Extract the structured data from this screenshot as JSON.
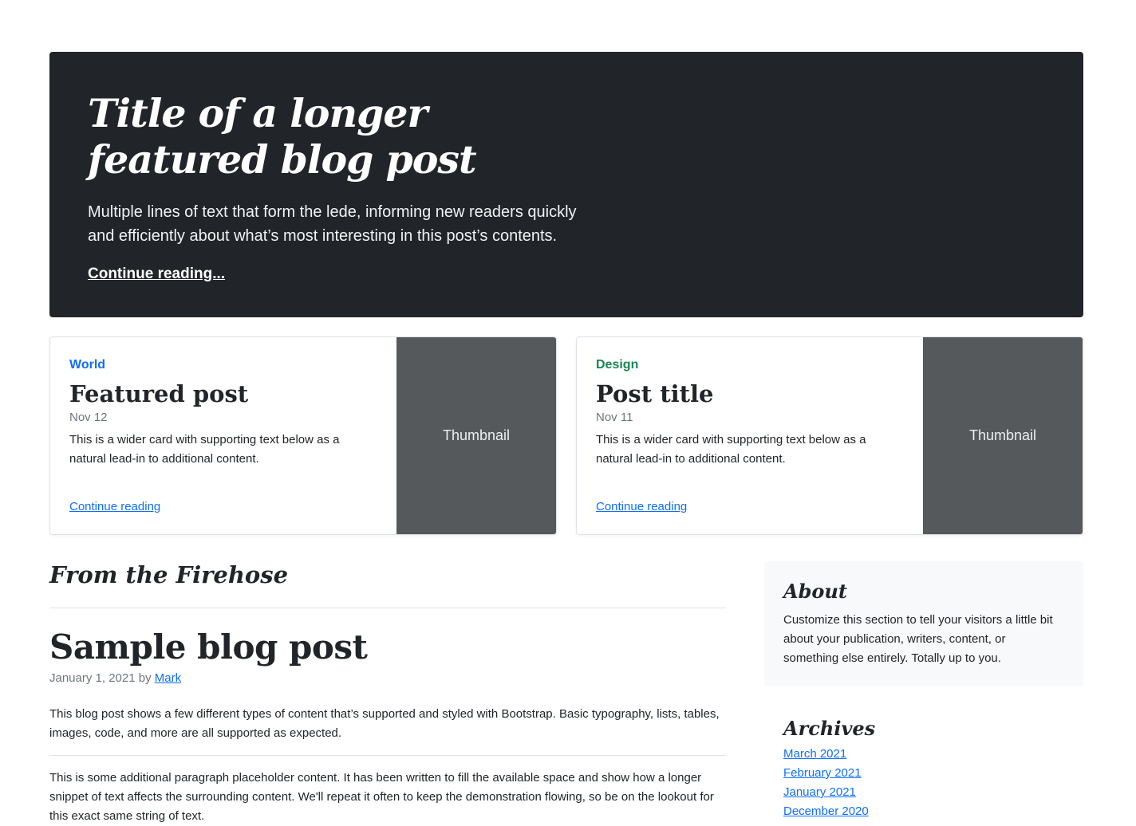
{
  "hero": {
    "title": "Title of a longer featured blog post",
    "lede": "Multiple lines of text that form the lede, informing new readers quickly and efficiently about what’s most interesting in this post’s contents.",
    "link": "Continue reading..."
  },
  "cards": [
    {
      "category": "World",
      "category_color": "#0d6efd",
      "title": "Featured post",
      "date": "Nov 12",
      "text": "This is a wider card with supporting text below as a natural lead-in to additional content.",
      "link": "Continue reading",
      "thumbnail": "Thumbnail"
    },
    {
      "category": "Design",
      "category_color": "#198754",
      "title": "Post title",
      "date": "Nov 11",
      "text": "This is a wider card with supporting text below as a natural lead-in to additional content.",
      "link": "Continue reading",
      "thumbnail": "Thumbnail"
    }
  ],
  "main": {
    "section_heading": "From the Firehose",
    "post": {
      "title": "Sample blog post",
      "date_by": "January 1, 2021 by",
      "author": "Mark",
      "intro": "This blog post shows a few different types of content that’s supported and styled with Bootstrap. Basic typography, lists, tables, images, code, and more are all supported as expected.",
      "paragraph": "This is some additional paragraph placeholder content. It has been written to fill the available space and show how a longer snippet of text affects the surrounding content. We'll repeat it often to keep the demonstration flowing, so be on the lookout for this exact same string of text."
    }
  },
  "sidebar": {
    "about": {
      "heading": "About",
      "text": "Customize this section to tell your visitors a little bit about your publication, writers, content, or something else entirely. Totally up to you."
    },
    "archives": {
      "heading": "Archives",
      "items": [
        "March 2021",
        "February 2021",
        "January 2021",
        "December 2020"
      ]
    }
  }
}
